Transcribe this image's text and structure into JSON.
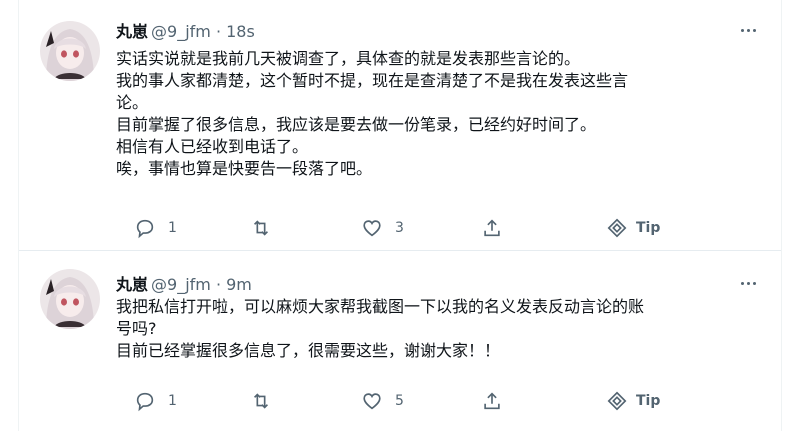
{
  "tweets": [
    {
      "author_name": "丸崽",
      "meta": "@9_jfm · 18s",
      "lines": [
        "实话实说就是我前几天被调查了，具体查的就是发表那些言论的。",
        "我的事人家都清楚，这个暂时不提，现在是查清楚了不是我在发表这些言",
        "论。",
        "目前掌握了很多信息，我应该是要去做一份笔录，已经约好时间了。",
        "相信有人已经收到电话了。",
        "唉，事情也算是快要告一段落了吧。"
      ],
      "reply_count": "1",
      "retweet_count": "",
      "like_count": "3",
      "tip_label": "Tip"
    },
    {
      "author_name": "丸崽",
      "meta": "@9_jfm · 9m",
      "lines": [
        "我把私信打开啦，可以麻烦大家帮我截图一下以我的名义发表反动言论的账",
        "号吗?",
        "目前已经掌握很多信息了，很需要这些，谢谢大家！！"
      ],
      "reply_count": "1",
      "retweet_count": "",
      "like_count": "5",
      "tip_label": "Tip"
    }
  ],
  "icons": {
    "reply": "reply-icon",
    "retweet": "retweet-icon",
    "like": "heart-icon",
    "share": "share-icon",
    "tip": "tip-icon",
    "more": "more-icon"
  },
  "colors": {
    "text": "#0f1419",
    "secondary": "#536471",
    "divider": "#e6ecf0"
  }
}
